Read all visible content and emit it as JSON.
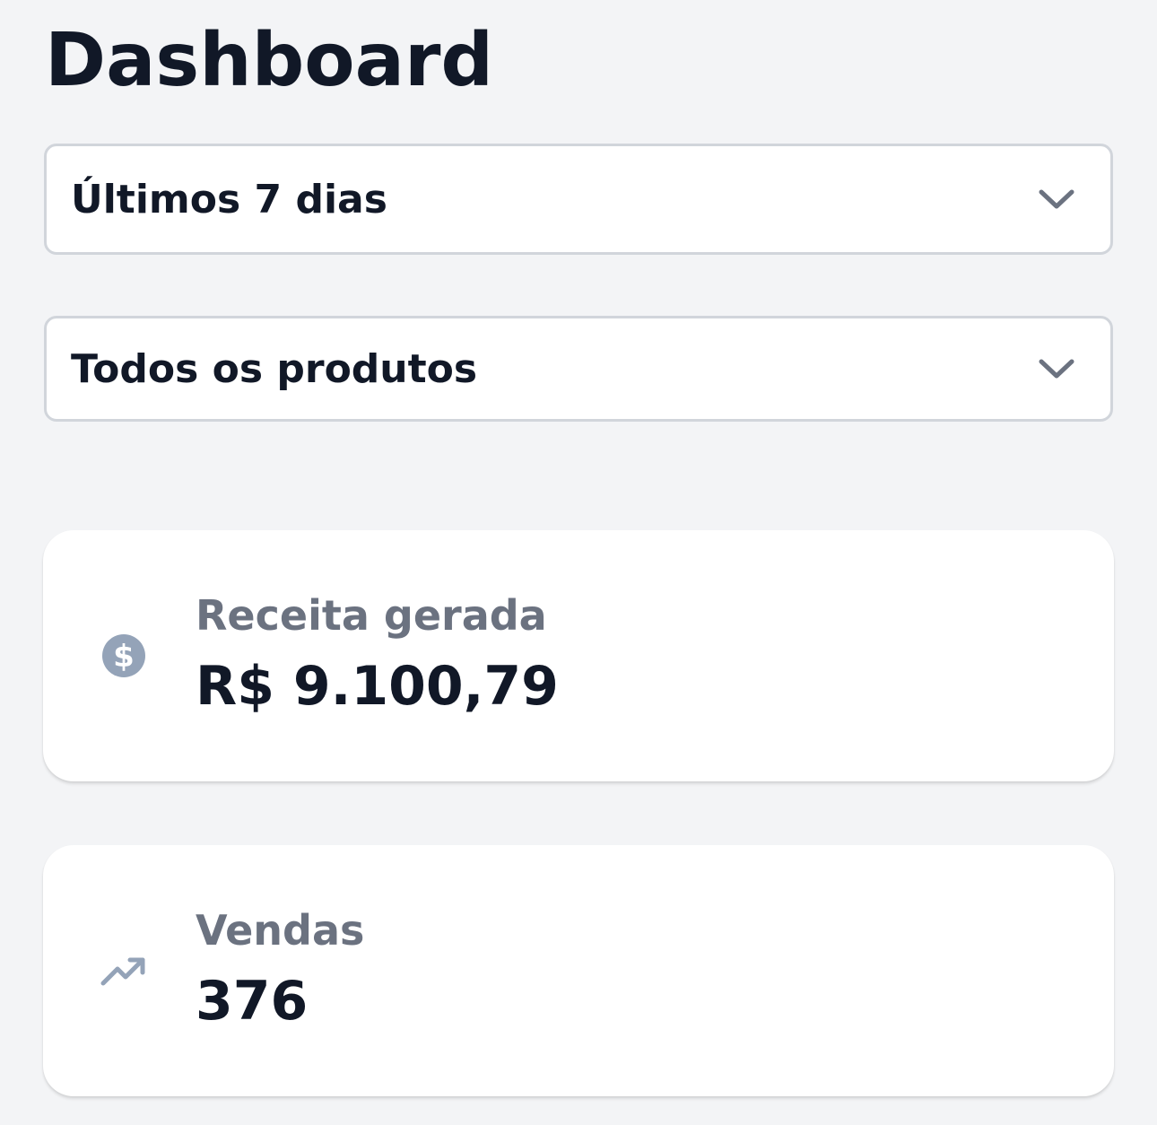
{
  "header": {
    "title": "Dashboard"
  },
  "filters": {
    "period": {
      "selected": "Últimos 7 dias"
    },
    "product": {
      "selected": "Todos os produtos"
    }
  },
  "stats": [
    {
      "icon": "dollar-circle-icon",
      "label": "Receita gerada",
      "value": "R$ 9.100,79"
    },
    {
      "icon": "trending-up-icon",
      "label": "Vendas",
      "value": "376"
    }
  ],
  "colors": {
    "background": "#f3f4f6",
    "text_primary": "#111827",
    "text_secondary": "#6b7280",
    "icon": "#94a3b8"
  }
}
